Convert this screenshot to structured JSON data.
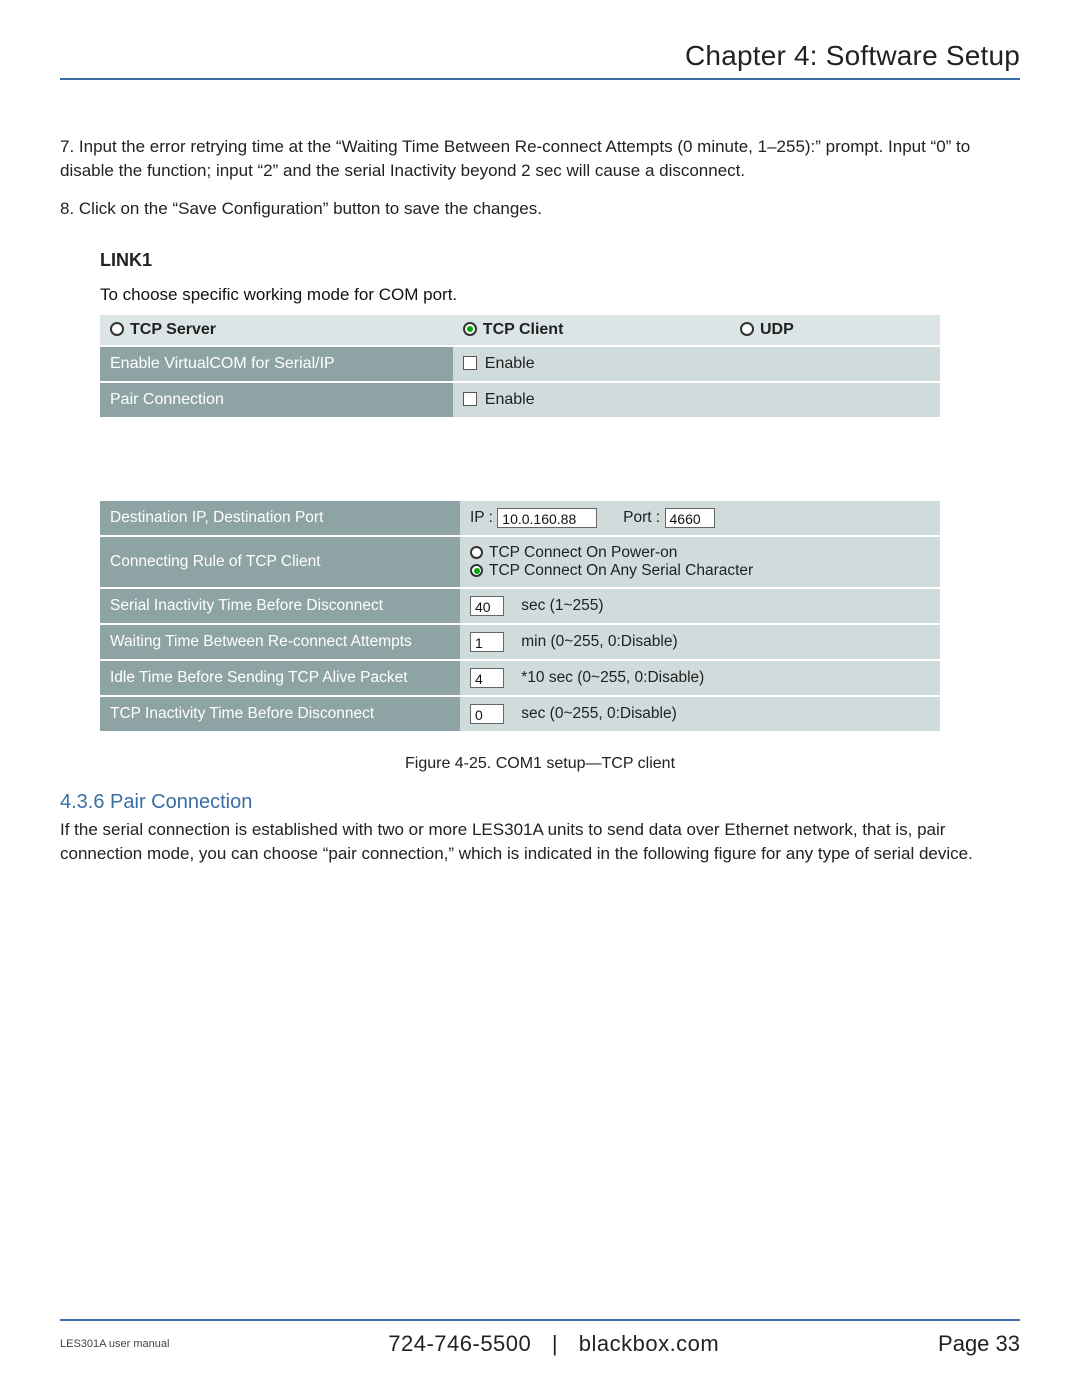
{
  "header": {
    "title": "Chapter 4: Software Setup"
  },
  "paragraphs": {
    "p7": "7. Input the error retrying time at the “Waiting Time Between Re-connect Attempts (0 minute, 1–255):” prompt. Input “0” to disable the function; input “2” and the serial Inactivity beyond 2 sec will cause a disconnect.",
    "p8": "8. Click on the “Save Configuration” button to save the changes."
  },
  "link1": {
    "title": "LINK1",
    "desc": "To choose specific working mode for COM port.",
    "modes": {
      "server": "TCP Server",
      "client": "TCP Client",
      "udp": "UDP",
      "selected": "client"
    },
    "row1": {
      "label": "Enable VirtualCOM for Serial/IP",
      "check_label": "Enable"
    },
    "row2": {
      "label": "Pair Connection",
      "check_label": "Enable"
    }
  },
  "settings": {
    "dest": {
      "label": "Destination IP, Destination Port",
      "ip_prefix": "IP :",
      "ip": "10.0.160.88",
      "port_prefix": "Port :",
      "port": "4660"
    },
    "rule": {
      "label": "Connecting Rule of TCP Client",
      "opt1": "TCP Connect On Power-on",
      "opt2": "TCP Connect On Any Serial Character",
      "selected": "opt2"
    },
    "ser_inact": {
      "label": "Serial Inactivity Time Before Disconnect",
      "value": "40",
      "unit": "sec (1~255)"
    },
    "wait": {
      "label": "Waiting Time Between Re-connect Attempts",
      "value": "1",
      "unit": "min (0~255, 0:Disable)"
    },
    "idle": {
      "label": "Idle Time Before Sending TCP Alive Packet",
      "value": "4",
      "unit": "*10 sec (0~255, 0:Disable)"
    },
    "tcp_inact": {
      "label": "TCP Inactivity Time Before Disconnect",
      "value": "0",
      "unit": "sec (0~255, 0:Disable)"
    }
  },
  "figure": "Figure 4-25. COM1 setup—TCP client",
  "section": {
    "num_title": "4.3.6 Pair Connection",
    "body": "If the serial connection is established with two or more LES301A units to send data over Ethernet network, that is, pair connection mode, you can choose “pair connection,” which is indicated in the following figure for any type of serial device."
  },
  "footer": {
    "manual": "LES301A user manual",
    "phone": "724-746-5500",
    "site": "blackbox.com",
    "page": "Page 33"
  }
}
